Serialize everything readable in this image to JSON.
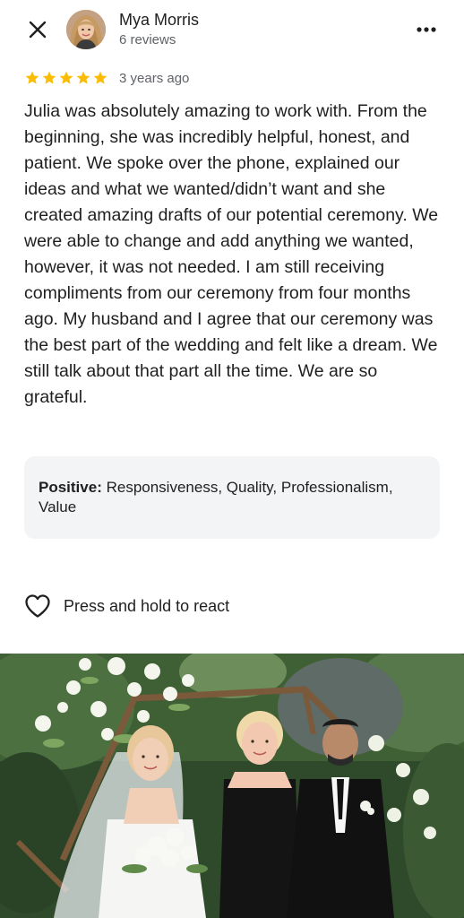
{
  "header": {
    "close_icon": "close-icon",
    "reviewer_name": "Mya Morris",
    "reviewer_meta": "6 reviews",
    "more_icon": "more-vert-icon"
  },
  "rating": {
    "stars": 5,
    "max_stars": 5,
    "star_color": "#fbbc04",
    "date": "3 years ago"
  },
  "review": {
    "text": "Julia was absolutely amazing to work with. From the beginning, she was incredibly helpful, honest, and patient. We spoke over the phone, explained our ideas and what we wanted/didn’t want and she created amazing drafts of our potential ceremony. We were able to change and add anything we wanted, however, it was not needed. I am still receiving compliments from our ceremony from four months ago. My husband and I agree that our ceremony was the best part of the wedding and felt like a dream. We still talk about that part all the time. We are so grateful."
  },
  "positive": {
    "label": "Positive:",
    "values": " Responsiveness, Quality, Professionalism, Value"
  },
  "react": {
    "icon": "heart-outline-icon",
    "label": "Press and hold to react"
  },
  "photo": {
    "subject": "wedding-photo"
  }
}
